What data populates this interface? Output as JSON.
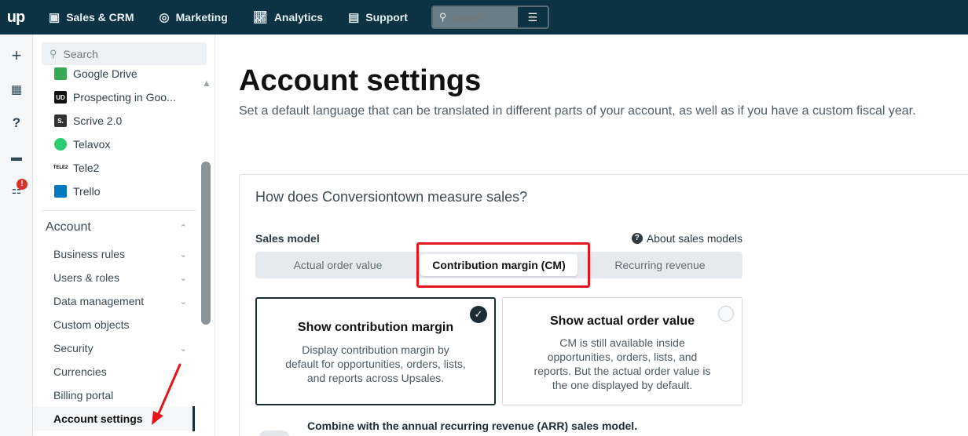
{
  "topbar": {
    "logo": "up",
    "nav": [
      {
        "label": "Sales & CRM",
        "icon": "briefcase-icon"
      },
      {
        "label": "Marketing",
        "icon": "target-icon"
      },
      {
        "label": "Analytics",
        "icon": "chart-line-icon"
      },
      {
        "label": "Support",
        "icon": "chat-icon"
      }
    ],
    "search_placeholder": "Search"
  },
  "rail": {
    "icons": [
      "plus-icon",
      "calendar-icon",
      "help-icon",
      "comment-icon",
      "notification-icon"
    ],
    "badge": "!"
  },
  "sidebar": {
    "search_placeholder": "Search",
    "apps": [
      {
        "label": "Google Drive",
        "color": "#34a853"
      },
      {
        "label": "Prospecting in Goo...",
        "color": "#111111",
        "glyph": "UD"
      },
      {
        "label": "Scrive 2.0",
        "color": "#333333",
        "glyph": "S."
      },
      {
        "label": "Telavox",
        "color": "#2ecc71"
      },
      {
        "label": "Tele2",
        "color": "#000000",
        "glyph": "TELE2"
      },
      {
        "label": "Trello",
        "color": "#0079bf"
      }
    ],
    "section": "Account",
    "links": [
      {
        "label": "Business rules",
        "chevron": true
      },
      {
        "label": "Users & roles",
        "chevron": true
      },
      {
        "label": "Data management",
        "chevron": true
      },
      {
        "label": "Custom objects",
        "chevron": false
      },
      {
        "label": "Security",
        "chevron": true
      },
      {
        "label": "Currencies",
        "chevron": false
      },
      {
        "label": "Billing portal",
        "chevron": false
      },
      {
        "label": "Account settings",
        "chevron": false
      }
    ]
  },
  "main": {
    "title": "Account settings",
    "subtitle": "Set a default language that can be translated in different parts of your account, as well as if you have a custom fiscal year.",
    "card": {
      "title": "How does Conversiontown measure sales?",
      "sales_model_label": "Sales model",
      "about_link": "About sales models",
      "segments": [
        "Actual order value",
        "Contribution margin (CM)",
        "Recurring revenue"
      ],
      "selected_segment": "Contribution margin (CM)",
      "options": [
        {
          "title": "Show contribution margin",
          "desc": "Display contribution margin by default for opportunities, orders, lists, and reports across Upsales.",
          "selected": true
        },
        {
          "title": "Show actual order value",
          "desc": "CM is still available inside opportunities, orders, lists, and reports. But the actual order value is the one displayed by default.",
          "selected": false
        }
      ],
      "combine_text": "Combine with the annual recurring revenue (ARR) sales model."
    }
  },
  "colors": {
    "topbar": "#0c3344",
    "highlight": "#e3151b",
    "accent": "#1c2d35"
  }
}
